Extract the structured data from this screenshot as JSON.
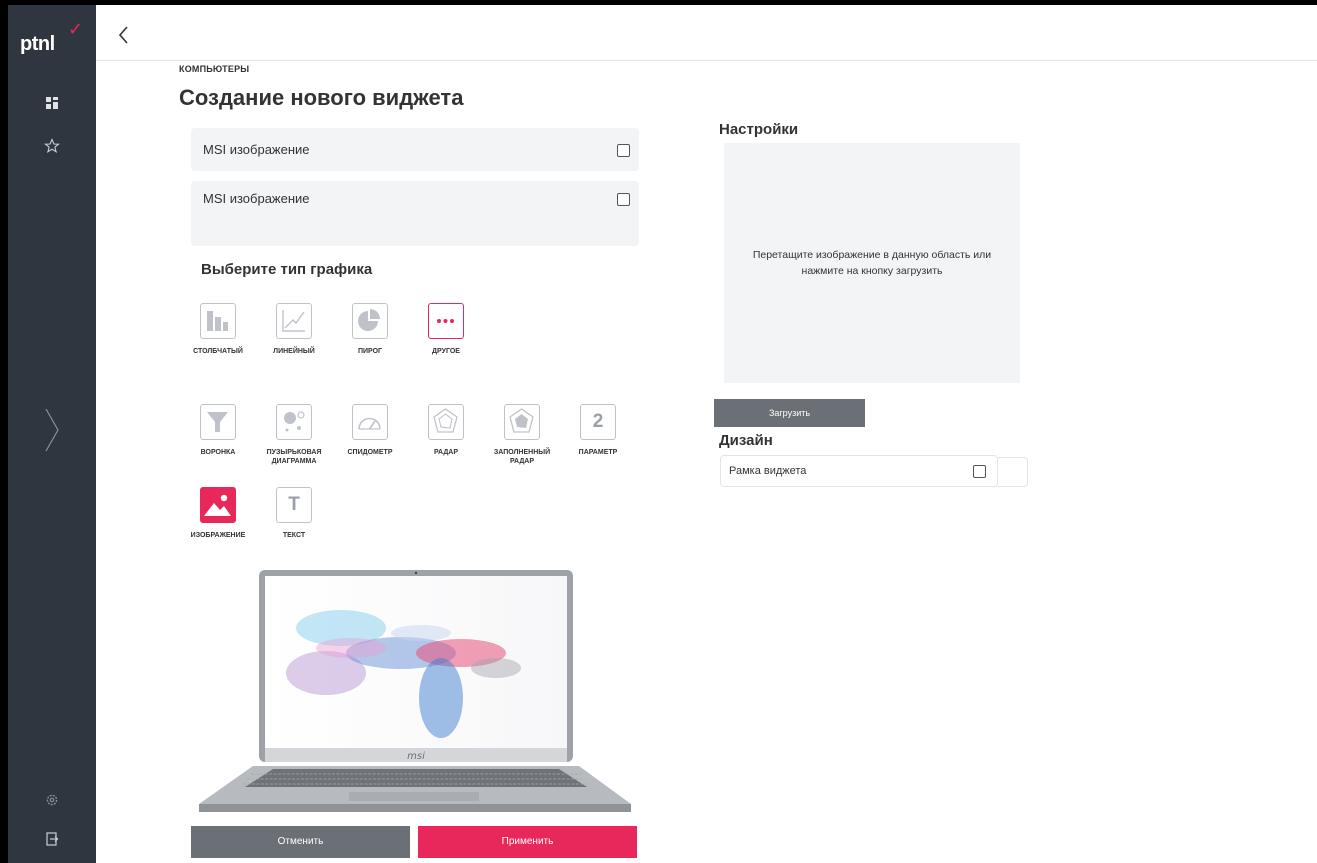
{
  "app": {
    "logo_text": "ptnl"
  },
  "sidebar": {
    "items": [
      {
        "name": "dashboard-icon"
      },
      {
        "name": "star-icon"
      },
      {
        "name": "chevron-right-icon"
      },
      {
        "name": "gear-icon"
      },
      {
        "name": "logout-icon"
      }
    ]
  },
  "header": {
    "breadcrumb": "КОМПЬЮТЕРЫ",
    "title": "Создание нового виджета"
  },
  "widget_names": [
    {
      "value": "MSI изображение"
    },
    {
      "value": "MSI изображение"
    }
  ],
  "chart_types": {
    "title": "Выберите тип графика",
    "row1": [
      {
        "label": "СТОЛБЧАТЫЙ",
        "icon": "bar-chart-icon"
      },
      {
        "label": "ЛИНЕЙНЫЙ",
        "icon": "line-chart-icon"
      },
      {
        "label": "ПИРОГ",
        "icon": "pie-chart-icon"
      },
      {
        "label": "ДРУГОЕ",
        "icon": "more-icon"
      }
    ],
    "row2": [
      {
        "label": "ВОРОНКА",
        "icon": "funnel-icon"
      },
      {
        "label": "ПУЗЫРЬКОВАЯ ДИАГРАММА",
        "icon": "bubble-chart-icon"
      },
      {
        "label": "СПИДОМЕТР",
        "icon": "speedometer-icon"
      },
      {
        "label": "РАДАР",
        "icon": "radar-icon"
      },
      {
        "label": "ЗАПОЛНЕННЫЙ РАДАР",
        "icon": "filled-radar-icon"
      },
      {
        "label": "ПАРАМЕТР",
        "icon": "parameter-icon",
        "glyph": "2"
      }
    ],
    "row3": [
      {
        "label": "ИЗОБРАЖЕНИЕ",
        "icon": "image-icon"
      },
      {
        "label": "ТЕКСТ",
        "icon": "text-icon",
        "glyph": "T"
      }
    ],
    "selected": "ИЗОБРАЖЕНИЕ"
  },
  "preview": {
    "brand_text": "msi"
  },
  "actions": {
    "cancel_label": "Отменить",
    "apply_label": "Применить"
  },
  "settings": {
    "title": "Настройки",
    "dropzone_text": "Перетащите изображение в данную область или нажмите на кнопку загрузить",
    "upload_label": "Загрузить"
  },
  "design": {
    "title": "Дизайн",
    "frame_label": "Рамка виджета"
  },
  "colors": {
    "accent": "#e8275a",
    "sidebar_bg": "#2f3640",
    "button_gray": "#6a7076",
    "panel_bg": "#f3f4f6"
  }
}
